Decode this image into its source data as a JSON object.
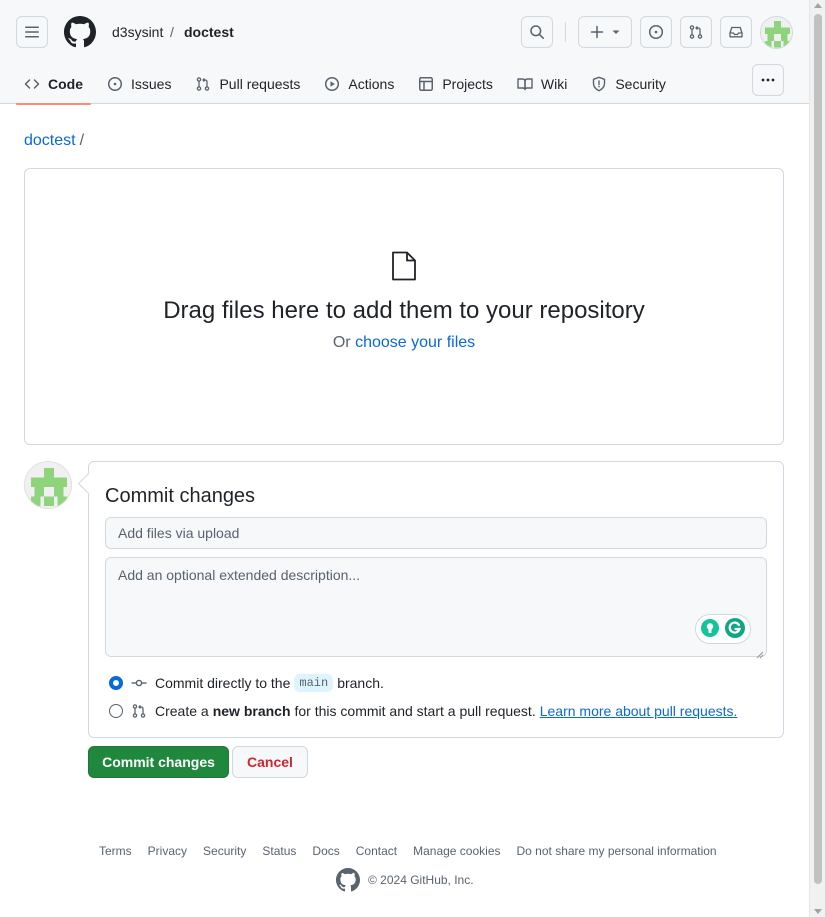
{
  "header": {
    "owner": "d3sysint",
    "separator": "/",
    "repo": "doctest"
  },
  "nav": {
    "tabs": [
      {
        "label": "Code",
        "icon": "code-icon",
        "active": true
      },
      {
        "label": "Issues",
        "icon": "issue-icon"
      },
      {
        "label": "Pull requests",
        "icon": "pull-request-icon"
      },
      {
        "label": "Actions",
        "icon": "play-icon"
      },
      {
        "label": "Projects",
        "icon": "table-icon"
      },
      {
        "label": "Wiki",
        "icon": "book-icon"
      },
      {
        "label": "Security",
        "icon": "shield-icon"
      }
    ]
  },
  "breadcrumb": {
    "repo": "doctest",
    "separator": "/"
  },
  "dropzone": {
    "title": "Drag files here to add them to your repository",
    "or_text": "Or",
    "choose_link": "choose your files"
  },
  "commit": {
    "title": "Commit changes",
    "summary_placeholder": "Add files via upload",
    "description_placeholder": "Add an optional extended description...",
    "option_direct_prefix": "Commit directly to the",
    "branch": "main",
    "option_direct_suffix": "branch.",
    "option_new_prefix": "Create a",
    "option_new_bold": "new branch",
    "option_new_suffix": "for this commit and start a pull request.",
    "learn_more": "Learn more about pull requests.",
    "submit_label": "Commit changes",
    "cancel_label": "Cancel"
  },
  "footer": {
    "links": [
      "Terms",
      "Privacy",
      "Security",
      "Status",
      "Docs",
      "Contact",
      "Manage cookies",
      "Do not share my personal information"
    ],
    "copyright": "© 2024 GitHub, Inc."
  },
  "colors": {
    "accent_link": "#0969da",
    "primary_button": "#1f883d",
    "danger": "#d1242f",
    "active_tab_underline": "#fd8c73"
  }
}
